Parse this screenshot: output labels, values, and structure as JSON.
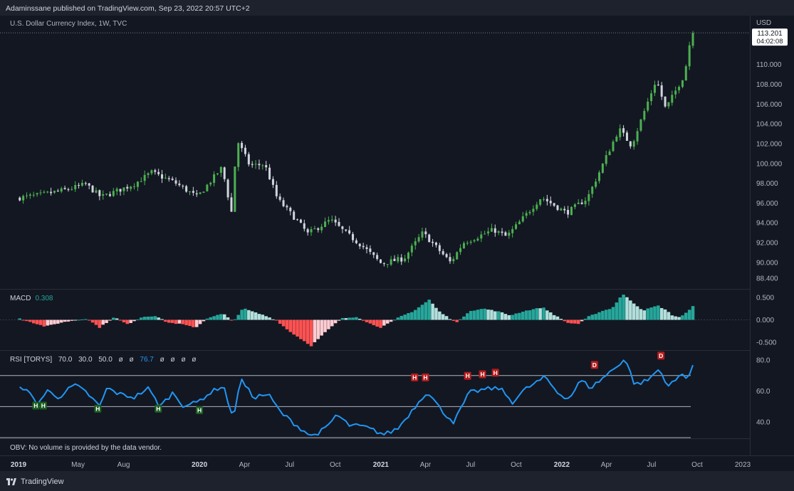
{
  "header": {
    "published": "Adaminssane published on TradingView.com, Sep 23, 2022 20:57 UTC+2"
  },
  "chart_data": [
    {
      "type": "candlestick",
      "title": "U.S. Dollar Currency Index, 1W, TVC",
      "currency": "USD",
      "last_price": "113.201",
      "countdown": "04:02:08",
      "ylim": [
        87.4,
        113.5
      ],
      "y_ticks": [
        "110.000",
        "108.000",
        "106.000",
        "104.000",
        "102.000",
        "100.000",
        "98.000",
        "96.000",
        "94.000",
        "92.000",
        "90.000",
        "88.400"
      ],
      "x_ticks": [
        "2019",
        "May",
        "Aug",
        "2020",
        "Apr",
        "Jul",
        "Oct",
        "2021",
        "Apr",
        "Jul",
        "Oct",
        "2022",
        "Apr",
        "Jul",
        "Oct",
        "2023"
      ],
      "x_ticks_bold": [
        "2019",
        "2020",
        "2021",
        "2022"
      ],
      "anchors": [
        [
          "2018-12-31",
          96.5
        ],
        [
          "2019-02-15",
          96.8
        ],
        [
          "2019-04-15",
          97.4
        ],
        [
          "2019-05-20",
          97.9
        ],
        [
          "2019-06-20",
          96.6
        ],
        [
          "2019-08-25",
          97.9
        ],
        [
          "2019-09-30",
          99.1
        ],
        [
          "2019-11-15",
          98.1
        ],
        [
          "2019-12-31",
          96.6
        ],
        [
          "2020-02-19",
          99.6
        ],
        [
          "2020-03-09",
          95.1
        ],
        [
          "2020-03-20",
          102.4
        ],
        [
          "2020-04-15",
          99.8
        ],
        [
          "2020-05-15",
          99.9
        ],
        [
          "2020-06-10",
          96.4
        ],
        [
          "2020-07-20",
          94.2
        ],
        [
          "2020-08-10",
          92.9
        ],
        [
          "2020-09-25",
          94.3
        ],
        [
          "2020-10-25",
          93.0
        ],
        [
          "2020-11-25",
          91.8
        ],
        [
          "2021-01-05",
          89.9
        ],
        [
          "2021-02-20",
          90.4
        ],
        [
          "2021-03-30",
          93.0
        ],
        [
          "2021-05-25",
          90.0
        ],
        [
          "2021-06-20",
          92.0
        ],
        [
          "2021-08-20",
          93.3
        ],
        [
          "2021-09-15",
          92.6
        ],
        [
          "2021-10-10",
          94.0
        ],
        [
          "2021-11-24",
          96.6
        ],
        [
          "2022-01-14",
          95.0
        ],
        [
          "2022-02-25",
          96.5
        ],
        [
          "2022-04-30",
          103.5
        ],
        [
          "2022-05-25",
          101.8
        ],
        [
          "2022-07-14",
          108.5
        ],
        [
          "2022-08-02",
          105.5
        ],
        [
          "2022-09-09",
          109.0
        ],
        [
          "2022-09-23",
          113.2
        ]
      ],
      "candle_color_up": "#4caf50",
      "candle_color_down": "#d1d4dc"
    },
    {
      "type": "bar",
      "name": "MACD",
      "value": "0.308",
      "value_color": "#26a69a",
      "ylim": [
        -0.66,
        0.66
      ],
      "y_ticks": [
        "0.500",
        "0.000",
        "-0.500"
      ],
      "anchors": [
        [
          "2018-12-31",
          0.03
        ],
        [
          "2019-01-20",
          -0.04
        ],
        [
          "2019-02-20",
          -0.15
        ],
        [
          "2019-03-25",
          -0.06
        ],
        [
          "2019-04-20",
          -0.01
        ],
        [
          "2019-05-15",
          0.03
        ],
        [
          "2019-06-10",
          -0.17
        ],
        [
          "2019-07-10",
          0.06
        ],
        [
          "2019-08-05",
          -0.1
        ],
        [
          "2019-09-05",
          0.07
        ],
        [
          "2019-10-01",
          0.09
        ],
        [
          "2019-10-25",
          -0.06
        ],
        [
          "2019-11-25",
          -0.1
        ],
        [
          "2019-12-20",
          -0.18
        ],
        [
          "2020-01-15",
          0.05
        ],
        [
          "2020-02-15",
          0.14
        ],
        [
          "2020-03-05",
          -0.05
        ],
        [
          "2020-03-25",
          0.26
        ],
        [
          "2020-04-20",
          0.16
        ],
        [
          "2020-05-10",
          0.09
        ],
        [
          "2020-06-01",
          -0.01
        ],
        [
          "2020-06-25",
          -0.24
        ],
        [
          "2020-08-10",
          -0.58
        ],
        [
          "2020-09-10",
          -0.25
        ],
        [
          "2020-10-10",
          0.03
        ],
        [
          "2020-11-10",
          0.07
        ],
        [
          "2020-12-01",
          -0.06
        ],
        [
          "2020-12-28",
          -0.17
        ],
        [
          "2021-01-15",
          -0.07
        ],
        [
          "2021-02-05",
          0.07
        ],
        [
          "2021-03-05",
          0.2
        ],
        [
          "2021-04-05",
          0.45
        ],
        [
          "2021-04-25",
          0.19
        ],
        [
          "2021-05-15",
          0.04
        ],
        [
          "2021-06-01",
          -0.06
        ],
        [
          "2021-06-25",
          0.2
        ],
        [
          "2021-07-25",
          0.25
        ],
        [
          "2021-08-25",
          0.18
        ],
        [
          "2021-09-15",
          0.1
        ],
        [
          "2021-10-15",
          0.2
        ],
        [
          "2021-11-20",
          0.28
        ],
        [
          "2021-12-15",
          0.1
        ],
        [
          "2022-01-10",
          -0.07
        ],
        [
          "2022-02-01",
          -0.09
        ],
        [
          "2022-02-20",
          0.07
        ],
        [
          "2022-03-15",
          0.18
        ],
        [
          "2022-04-10",
          0.27
        ],
        [
          "2022-04-30",
          0.58
        ],
        [
          "2022-05-20",
          0.4
        ],
        [
          "2022-06-10",
          0.21
        ],
        [
          "2022-07-10",
          0.32
        ],
        [
          "2022-07-25",
          0.23
        ],
        [
          "2022-08-10",
          0.09
        ],
        [
          "2022-08-25",
          0.06
        ],
        [
          "2022-09-10",
          0.2
        ],
        [
          "2022-09-23",
          0.308
        ]
      ],
      "color_pos_strong": "#26a69a",
      "color_pos_weak": "#b2dfdb",
      "color_neg_strong": "#ff5252",
      "color_neg_weak": "#ffcdd2"
    },
    {
      "type": "line",
      "name": "RSI",
      "legend_label": "RSI [TORYS]",
      "params": [
        "70.0",
        "30.0",
        "50.0",
        "ø",
        "ø"
      ],
      "value": "76.7",
      "value_color": "#2196f3",
      "trailing": [
        "ø",
        "ø",
        "ø",
        "ø"
      ],
      "ylim": [
        30,
        85
      ],
      "y_ticks": [
        "80.0",
        "60.0",
        "40.0"
      ],
      "bands": [
        70,
        50,
        30
      ],
      "line_color": "#2196f3",
      "anchors": [
        [
          "2018-12-31",
          64
        ],
        [
          "2019-01-20",
          58
        ],
        [
          "2019-02-05",
          52
        ],
        [
          "2019-02-25",
          60
        ],
        [
          "2019-03-20",
          56
        ],
        [
          "2019-04-20",
          64
        ],
        [
          "2019-05-15",
          59
        ],
        [
          "2019-06-10",
          50
        ],
        [
          "2019-06-25",
          62
        ],
        [
          "2019-07-20",
          58
        ],
        [
          "2019-08-20",
          56
        ],
        [
          "2019-09-15",
          62
        ],
        [
          "2019-10-10",
          50
        ],
        [
          "2019-11-05",
          59
        ],
        [
          "2019-11-25",
          51
        ],
        [
          "2019-12-20",
          52
        ],
        [
          "2020-01-15",
          58
        ],
        [
          "2020-02-15",
          64
        ],
        [
          "2020-03-05",
          41
        ],
        [
          "2020-03-20",
          68
        ],
        [
          "2020-04-15",
          56
        ],
        [
          "2020-05-15",
          58
        ],
        [
          "2020-06-10",
          46
        ],
        [
          "2020-07-15",
          37
        ],
        [
          "2020-08-10",
          31
        ],
        [
          "2020-09-10",
          36
        ],
        [
          "2020-09-30",
          45
        ],
        [
          "2020-10-25",
          38
        ],
        [
          "2020-11-25",
          37
        ],
        [
          "2021-01-05",
          32
        ],
        [
          "2021-02-01",
          36
        ],
        [
          "2021-03-05",
          49
        ],
        [
          "2021-04-01",
          60
        ],
        [
          "2021-05-01",
          47
        ],
        [
          "2021-05-25",
          40
        ],
        [
          "2021-06-25",
          59
        ],
        [
          "2021-07-25",
          61
        ],
        [
          "2021-08-25",
          62
        ],
        [
          "2021-09-20",
          53
        ],
        [
          "2021-10-15",
          61
        ],
        [
          "2021-11-25",
          69
        ],
        [
          "2021-12-20",
          59
        ],
        [
          "2022-01-12",
          55
        ],
        [
          "2022-02-05",
          67
        ],
        [
          "2022-02-25",
          62
        ],
        [
          "2022-04-15",
          75
        ],
        [
          "2022-05-05",
          81
        ],
        [
          "2022-05-25",
          64
        ],
        [
          "2022-06-20",
          67
        ],
        [
          "2022-07-12",
          74
        ],
        [
          "2022-08-02",
          63
        ],
        [
          "2022-08-28",
          71
        ],
        [
          "2022-09-09",
          69
        ],
        [
          "2022-09-23",
          76.7
        ]
      ],
      "markers": [
        {
          "date": "2019-02-05",
          "value": 55,
          "label": "H",
          "kind": "bull"
        },
        {
          "date": "2019-02-20",
          "value": 55,
          "label": "H",
          "kind": "bull"
        },
        {
          "date": "2019-06-10",
          "value": 53,
          "label": "H",
          "kind": "bull"
        },
        {
          "date": "2019-10-10",
          "value": 53,
          "label": "H",
          "kind": "bull"
        },
        {
          "date": "2020-01-01",
          "value": 52,
          "label": "H",
          "kind": "bull"
        },
        {
          "date": "2021-03-10",
          "value": 64,
          "label": "H",
          "kind": "bear"
        },
        {
          "date": "2021-04-01",
          "value": 64,
          "label": "H",
          "kind": "bear"
        },
        {
          "date": "2021-06-25",
          "value": 65,
          "label": "H",
          "kind": "bear"
        },
        {
          "date": "2021-07-25",
          "value": 66,
          "label": "H",
          "kind": "bear"
        },
        {
          "date": "2021-08-20",
          "value": 67,
          "label": "H",
          "kind": "bear"
        },
        {
          "date": "2022-03-08",
          "value": 72,
          "label": "D",
          "kind": "bear"
        },
        {
          "date": "2022-07-20",
          "value": 78,
          "label": "D",
          "kind": "bear"
        }
      ]
    }
  ],
  "obv": {
    "text": "OBV: No volume is provided by the data vendor."
  },
  "footer": {
    "brand": "TradingView"
  }
}
